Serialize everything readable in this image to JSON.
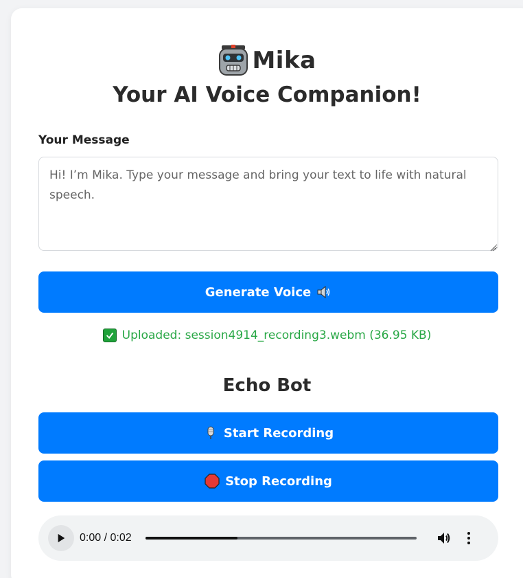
{
  "header": {
    "app_name": "Mika",
    "subtitle": "Your AI Voice Companion!",
    "logo_icon": "robot-face-icon"
  },
  "message": {
    "label": "Your Message",
    "placeholder": "Hi! I’m Mika. Type your message and bring your text to life with natural speech.",
    "value": ""
  },
  "generate_button": {
    "label": "Generate Voice",
    "icon": "speaker-icon"
  },
  "upload_status": {
    "icon": "check-mark-icon",
    "text": "Uploaded: session4914_recording3.webm (36.95 KB)"
  },
  "echo_bot": {
    "title": "Echo Bot",
    "start_label": "Start Recording",
    "start_icon": "microphone-icon",
    "stop_label": "Stop Recording",
    "stop_icon": "stop-sign-icon"
  },
  "audio_player": {
    "time": "0:00 / 0:02",
    "progress": 0.34
  },
  "colors": {
    "primary": "#007bff",
    "success": "#28a745",
    "text": "#2b2b2b",
    "background": "#f2f3f5"
  }
}
